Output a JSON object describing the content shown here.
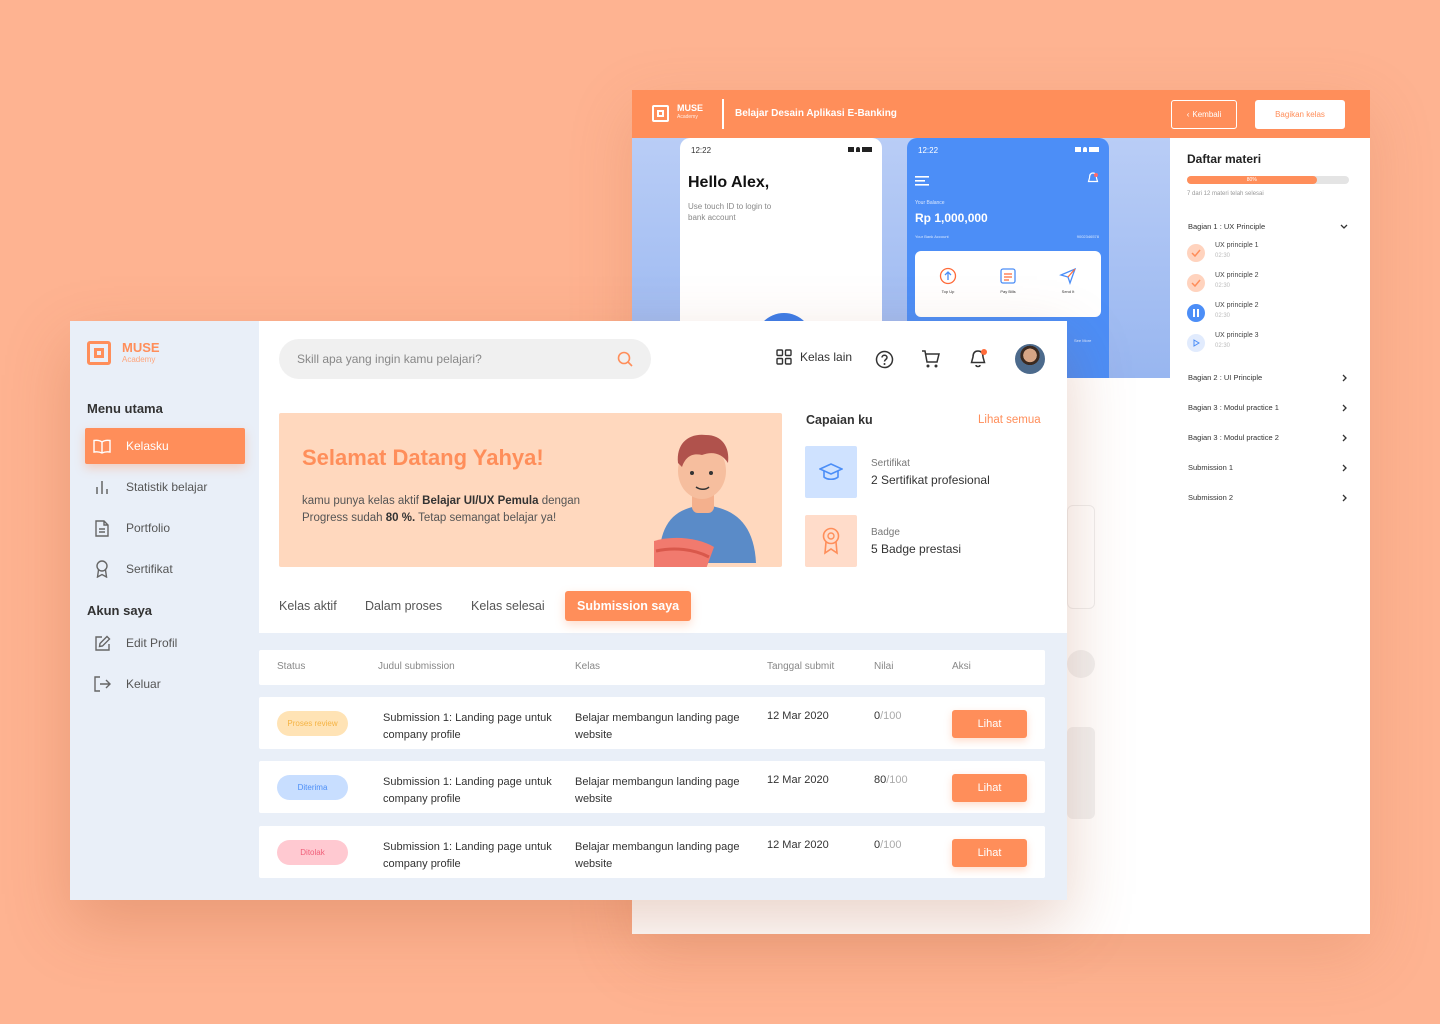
{
  "back_window": {
    "brand": "MUSE",
    "brand_sub": "Academy",
    "course_title": "Belajar Desain Aplikasi E-Banking",
    "kembali_label": "Kembali",
    "bagikan_label": "Bagikan kelas",
    "phone1": {
      "time": "12:22",
      "hello": "Hello Alex,",
      "subtitle": "Use touch ID to login to bank account"
    },
    "phone2": {
      "time": "12:22",
      "balance_label": "Your Balance",
      "balance": "Rp 1,000,000",
      "account_label": "Your Bank Account",
      "account_number": "9002346578",
      "actions": [
        "Top Up",
        "Pay Bills",
        "Send It"
      ],
      "see_more": "See More"
    },
    "daftar": {
      "title": "Daftar materi",
      "progress_label": "80%",
      "progress_value": 0.8,
      "progress_sub": "7 dari 12 materi telah selesai",
      "sections": [
        {
          "label": "Bagian 1 : UX Principle"
        },
        {
          "label": "Bagian 2 : UI Principle"
        },
        {
          "label": "Bagian 3 : Modul practice 1"
        },
        {
          "label": "Bagian 3 : Modul practice 2"
        },
        {
          "label": "Submission 1"
        },
        {
          "label": "Submission 2"
        }
      ],
      "lessons": [
        {
          "name": "UX principle 1",
          "time": "02:30"
        },
        {
          "name": "UX principle 2",
          "time": "02:30"
        },
        {
          "name": "UX principle 2",
          "time": "02:30"
        },
        {
          "name": "UX principle 3",
          "time": "02:30"
        }
      ]
    }
  },
  "sidebar": {
    "brand": "MUSE",
    "brand_sub": "Academy",
    "menu_utama": "Menu utama",
    "akun_saya": "Akun saya",
    "items": [
      {
        "label": "Kelasku"
      },
      {
        "label": "Statistik belajar"
      },
      {
        "label": "Portfolio"
      },
      {
        "label": "Sertifikat"
      },
      {
        "label": "Edit Profil"
      },
      {
        "label": "Keluar"
      }
    ]
  },
  "header": {
    "search_placeholder": "Skill apa yang ingin kamu pelajari?",
    "kelas_lain": "Kelas lain"
  },
  "banner": {
    "title": "Selamat Datang Yahya!",
    "text_1": "kamu punya kelas aktif ",
    "course": "Belajar UI/UX Pemula",
    "text_2": " dengan Progress sudah ",
    "progress": "80 %.",
    "text_3": " Tetap semangat belajar ya!"
  },
  "capaian": {
    "title": "Capaian ku",
    "link": "Lihat semua",
    "items": [
      {
        "label": "Sertifikat",
        "value": "2 Sertifikat profesional"
      },
      {
        "label": "Badge",
        "value": "5 Badge prestasi"
      }
    ]
  },
  "tabs": [
    "Kelas aktif",
    "Dalam proses",
    "Kelas selesai",
    "Submission saya"
  ],
  "table": {
    "headers": [
      "Status",
      "Judul submission",
      "Kelas",
      "Tanggal submit",
      "Nilai",
      "Aksi"
    ],
    "rows": [
      {
        "status": "Proses review",
        "judul": "Submission 1: Landing page untuk company profile",
        "kelas": "Belajar membangun landing page website",
        "tanggal": "12 Mar 2020",
        "nilai": "0",
        "max": "/100",
        "aksi": "Lihat"
      },
      {
        "status": "Diterima",
        "judul": "Submission 1: Landing page untuk company profile",
        "kelas": "Belajar membangun landing page website",
        "tanggal": "12 Mar 2020",
        "nilai": "80",
        "max": "/100",
        "aksi": "Lihat"
      },
      {
        "status": "Ditolak",
        "judul": "Submission 1: Landing page untuk company profile",
        "kelas": "Belajar membangun landing page website",
        "tanggal": "12 Mar 2020",
        "nilai": "0",
        "max": "/100",
        "aksi": "Lihat"
      }
    ]
  },
  "colors": {
    "accent": "#FF8E5A",
    "background": "#FEB391",
    "status_review": "#FFE3B5",
    "status_accepted": "#C8DEFF",
    "status_rejected": "#FFC9D1"
  }
}
